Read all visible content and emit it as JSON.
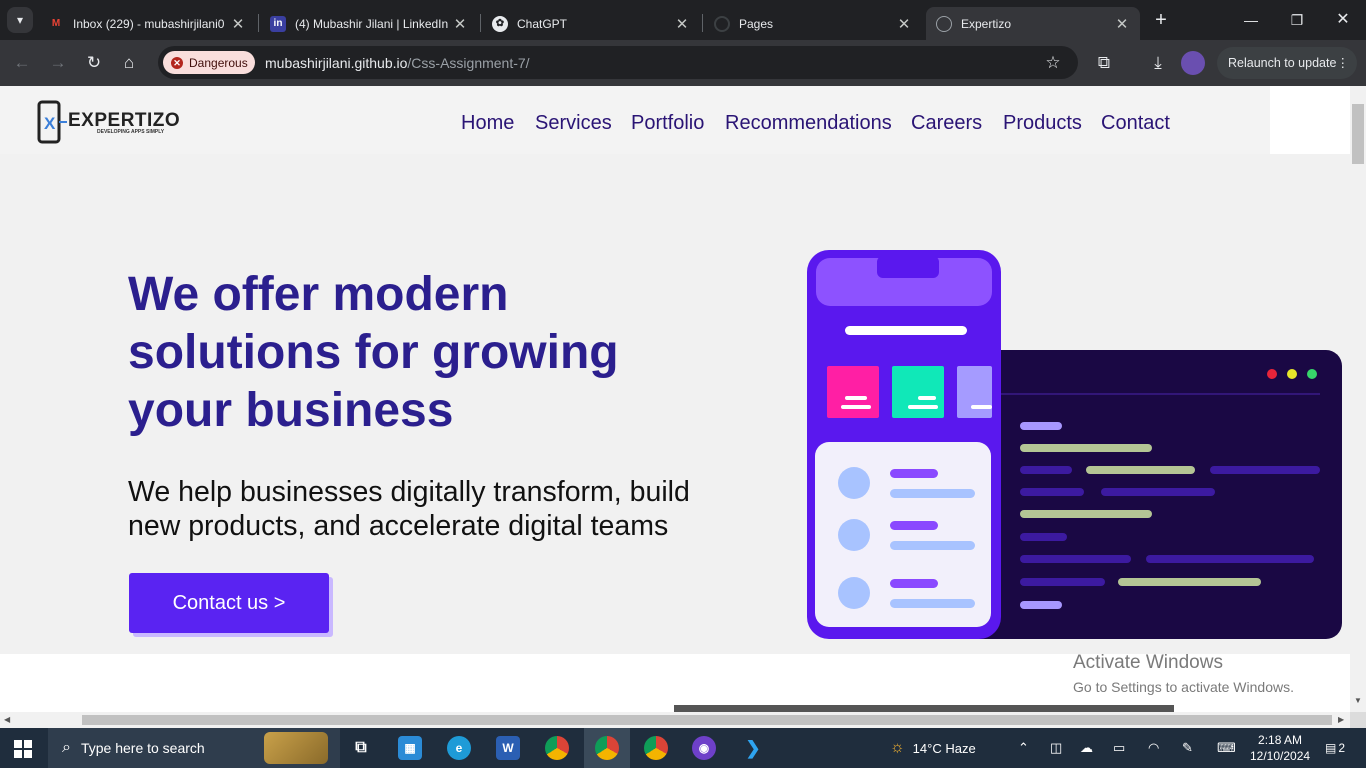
{
  "browser": {
    "tabs": [
      {
        "title": "Inbox (229) - mubashirjilani0",
        "icon": "gmail-icon"
      },
      {
        "title": "(4) Mubashir Jilani | LinkedIn",
        "icon": "linkedin-icon"
      },
      {
        "title": "ChatGPT",
        "icon": "chatgpt-icon"
      },
      {
        "title": "Pages",
        "icon": "github-icon"
      },
      {
        "title": "Expertizo",
        "icon": "globe-icon"
      }
    ],
    "security_label": "Dangerous",
    "url_host": "mubashirjilani.github.io",
    "url_path": "/Css-Assignment-7/",
    "relaunch_label": "Relaunch to update"
  },
  "site": {
    "logo_text": "EXPERTIZO",
    "logo_tagline": "DEVELOPING APPS SIMPLY",
    "nav": [
      "Home",
      "Services",
      "Portfolio",
      "Recommendations",
      "Careers",
      "Products",
      "Contact"
    ],
    "hero_title": "We offer modern solutions for growing your business",
    "hero_subtitle": "We help businesses digitally transform, build new products, and accelerate digital teams",
    "cta_label": "Contact us >"
  },
  "windows_watermark": {
    "line1": "Activate Windows",
    "line2": "Go to Settings to activate Windows."
  },
  "taskbar": {
    "search_placeholder": "Type here to search",
    "weather": "14°C  Haze",
    "time": "2:18 AM",
    "date": "12/10/2024",
    "notifications": "2"
  },
  "colors": {
    "brand_purple": "#5a23f2",
    "heading": "#2b1f8e",
    "nav": "#2a1475"
  }
}
